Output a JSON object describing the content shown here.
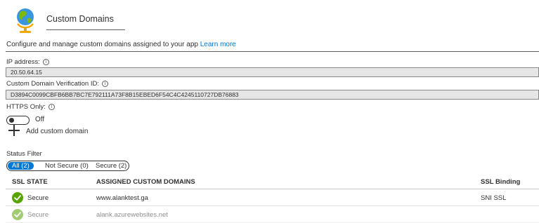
{
  "header": {
    "title": "Custom Domains",
    "icon": "globe-icon"
  },
  "description": {
    "text": "Configure and manage custom domains assigned to your app",
    "link": "Learn more"
  },
  "ip": {
    "label": "IP address:",
    "value": "20.50.64.15"
  },
  "verification": {
    "label": "Custom Domain Verification ID:",
    "value": "D3894C0099CBFB6BB7BC7E792111A73F8B15EBED6F54C4C4245110727DB76883"
  },
  "https": {
    "label": "HTTPS Only:",
    "state": "Off"
  },
  "add_domain": {
    "label": "Add custom domain"
  },
  "status_filter": {
    "label": "Status Filter",
    "options": [
      "All (2)",
      "Not Secure (0)",
      "Secure (2)"
    ],
    "selected": "All (2)"
  },
  "table": {
    "columns": [
      "SSL STATE",
      "ASSIGNED CUSTOM DOMAINS",
      "SSL Binding"
    ],
    "rows": [
      {
        "state": "Secure",
        "domain": "www.alanktest.ga",
        "binding": "SNI SSL"
      },
      {
        "state": "Secure",
        "domain": "alank.azurewebsites.net",
        "binding": ""
      }
    ]
  },
  "colors": {
    "accent": "#0078d4",
    "success": "#57a300",
    "field_bg": "#e6e6e6"
  }
}
